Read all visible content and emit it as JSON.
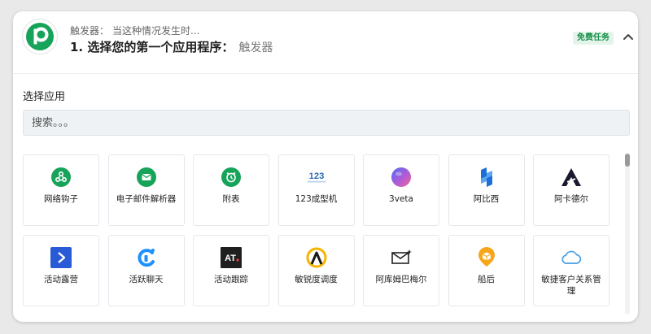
{
  "header": {
    "trigger_label": "触发器：",
    "trigger_text": "当这种情况发生时...",
    "step_title": "1. 选择您的第一个应用程序：",
    "step_event": "触发器",
    "badge": "免费任务",
    "logo_letter": "P",
    "brand_color": "#17a45a"
  },
  "select_app": {
    "label": "选择应用",
    "search_placeholder": "搜索。。。"
  },
  "apps": [
    {
      "name": "网络钩子",
      "icon": "webhook-icon"
    },
    {
      "name": "电子邮件解析器",
      "icon": "email-parser-icon"
    },
    {
      "name": "附表",
      "icon": "alarm-clock-icon"
    },
    {
      "name": "123成型机",
      "icon": "123formbuilder-icon",
      "icon_text": "123"
    },
    {
      "name": "3veta",
      "icon": "3veta-icon"
    },
    {
      "name": "阿比西",
      "icon": "abyssale-icon"
    },
    {
      "name": "阿卡德尔",
      "icon": "accredible-icon"
    },
    {
      "name": "活动露营",
      "icon": "activecampaign-icon"
    },
    {
      "name": "活跃聊天",
      "icon": "activechat-icon"
    },
    {
      "name": "活动跟踪",
      "icon": "activetrail-icon",
      "icon_text": "AT"
    },
    {
      "name": "敏锐度调度",
      "icon": "acuity-scheduling-icon"
    },
    {
      "name": "阿库姆巴梅尔",
      "icon": "acumbamail-icon"
    },
    {
      "name": "船后",
      "icon": "aftership-icon"
    },
    {
      "name": "敏捷客户关系管理",
      "icon": "agile-crm-icon"
    }
  ]
}
